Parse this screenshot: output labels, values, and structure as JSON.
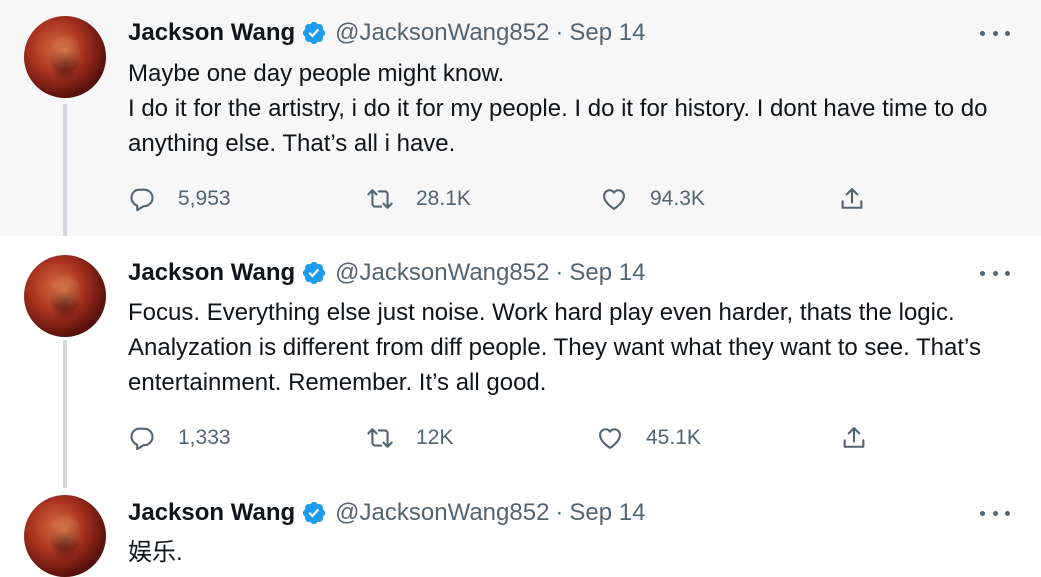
{
  "tweets": [
    {
      "name": "Jackson Wang",
      "handle": "@JacksonWang852",
      "separator": "·",
      "date": "Sep 14",
      "text": "Maybe one day people might know.\nI do it for the artistry, i do it for my people. I do it for history. I dont have time to do anything else. That’s all i have.",
      "replies": "5,953",
      "retweets": "28.1K",
      "likes": "94.3K"
    },
    {
      "name": "Jackson Wang",
      "handle": "@JacksonWang852",
      "separator": "·",
      "date": "Sep 14",
      "text": "Focus. Everything else just noise. Work hard play even harder, thats the logic. Analyzation is different from diff people. They want what they want to see. That’s entertainment. Remember. It’s all good.",
      "replies": "1,333",
      "retweets": "12K",
      "likes": "45.1K"
    },
    {
      "name": "Jackson Wang",
      "handle": "@JacksonWang852",
      "separator": "·",
      "date": "Sep 14",
      "text": "娱乐."
    }
  ],
  "colors": {
    "verified": "#1d9bf0",
    "secondary_text": "#536471",
    "highlight_bg": "#f7f7f7",
    "thread_line": "#cfd9de"
  },
  "icons": [
    "verified-badge-icon",
    "more-icon",
    "reply-icon",
    "retweet-icon",
    "like-icon",
    "share-icon"
  ]
}
